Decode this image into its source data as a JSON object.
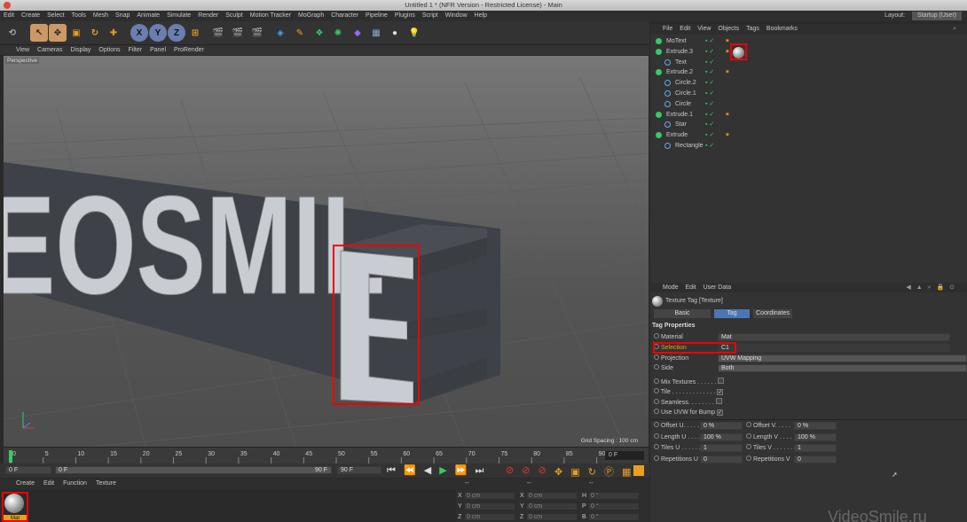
{
  "window": {
    "title": "Untitled 1 * (NFR Version - Restricted License) - Main"
  },
  "menubar": {
    "items": [
      "Edit",
      "Create",
      "Select",
      "Tools",
      "Mesh",
      "Snap",
      "Animate",
      "Simulate",
      "Render",
      "Sculpt",
      "Motion Tracker",
      "MoGraph",
      "Character",
      "Pipeline",
      "Plugins",
      "Script",
      "Window",
      "Help"
    ],
    "layout_label": "Layout:",
    "layout_value": "Startup (User)"
  },
  "viewport_menu": {
    "items": [
      "View",
      "Cameras",
      "Display",
      "Options",
      "Filter",
      "Panel",
      "ProRender"
    ],
    "view_name": "Perspective",
    "grid_spacing": "Grid Spacing : 100 cm"
  },
  "scene_text": "EOSMILE",
  "timeline": {
    "ticks": [
      "0",
      "5",
      "10",
      "15",
      "20",
      "25",
      "30",
      "35",
      "40",
      "45",
      "50",
      "55",
      "60",
      "65",
      "70",
      "75",
      "80",
      "85",
      "90"
    ],
    "current_frame": "0 F"
  },
  "transport": {
    "start": "0 F",
    "start2": "0 F",
    "end": "90 F",
    "end2": "90 F"
  },
  "material_manager": {
    "menu": [
      "Create",
      "Edit",
      "Function",
      "Texture"
    ],
    "material_name": "Mat"
  },
  "coordinates": {
    "header": [
      "--",
      "--",
      "--"
    ],
    "rows": [
      [
        "X",
        "0 cm",
        "X",
        "0 cm",
        "H",
        "0 °"
      ],
      [
        "Y",
        "0 cm",
        "Y",
        "0 cm",
        "P",
        "0 °"
      ],
      [
        "Z",
        "0 cm",
        "Z",
        "0 cm",
        "B",
        "0 °"
      ]
    ]
  },
  "object_manager": {
    "menu": [
      "File",
      "Edit",
      "View",
      "Objects",
      "Tags",
      "Bookmarks"
    ],
    "objects": [
      {
        "name": "MoText",
        "indent": 0
      },
      {
        "name": "Extrude.3",
        "indent": 0
      },
      {
        "name": "Text",
        "indent": 1
      },
      {
        "name": "Extrude.2",
        "indent": 0
      },
      {
        "name": "Circle.2",
        "indent": 1
      },
      {
        "name": "Circle.1",
        "indent": 1
      },
      {
        "name": "Circle",
        "indent": 1
      },
      {
        "name": "Extrude.1",
        "indent": 0
      },
      {
        "name": "Star",
        "indent": 1
      },
      {
        "name": "Extrude",
        "indent": 0
      },
      {
        "name": "Rectangle",
        "indent": 1
      }
    ]
  },
  "attribute_manager": {
    "menu": [
      "Mode",
      "Edit",
      "User Data"
    ],
    "title": "Texture Tag [Texture]",
    "tabs": [
      "Basic",
      "Tag",
      "Coordinates"
    ],
    "section": "Tag Properties",
    "material_label": "Material",
    "material_value": "Mat",
    "selection_label": "Selection",
    "selection_value": "C1",
    "projection_label": "Projection",
    "projection_value": "UVW Mapping",
    "side_label": "Side",
    "side_value": "Both",
    "mix_textures": "Mix Textures . . . . . .",
    "tile": "Tile . . . . . . . . . . . . .",
    "seamless": "Seamless. . . . . . . .",
    "uvw_bump": "Use UVW for Bump",
    "offset_u": "Offset U. . . . .",
    "offset_u_val": "0 %",
    "offset_v": "Offset V. . . . .",
    "offset_v_val": "0 %",
    "length_u": "Length U . . . .",
    "length_u_val": "100 %",
    "length_v": "Length V . . . .",
    "length_v_val": "100 %",
    "tiles_u": "Tiles U . . . . . .",
    "tiles_u_val": "1",
    "tiles_v": "Tiles V . . . . . .",
    "tiles_v_val": "1",
    "rep_u": "Repetitions U",
    "rep_u_val": "0",
    "rep_v": "Repetitions V",
    "rep_v_val": "0"
  },
  "watermark": "VideoSmile.ru"
}
